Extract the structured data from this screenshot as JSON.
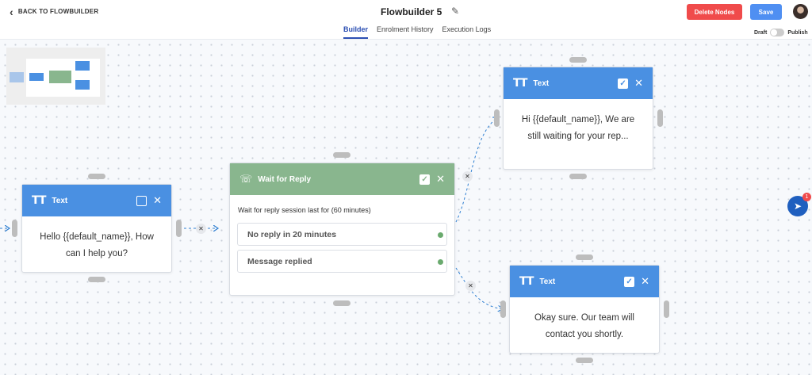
{
  "header": {
    "back_label": "BACK TO FLOWBUILDER",
    "title": "Flowbuilder 5",
    "tabs": [
      {
        "label": "Builder",
        "active": true
      },
      {
        "label": "Enrolment History",
        "active": false
      },
      {
        "label": "Execution Logs",
        "active": false
      }
    ],
    "delete_label": "Delete Nodes",
    "save_label": "Save",
    "draft_label": "Draft",
    "publish_label": "Publish"
  },
  "nodes": {
    "text1": {
      "title": "Text",
      "body": "Hello {{default_name}}, How can I help you?",
      "checked": false
    },
    "wait": {
      "title": "Wait for Reply",
      "description": "Wait for reply session last for (60 minutes)",
      "options": [
        "No reply in 20 minutes",
        "Message replied"
      ],
      "checked": true
    },
    "text2": {
      "title": "Text",
      "body": "Hi {{default_name}}, We are still waiting for your rep...",
      "checked": true
    },
    "text3": {
      "title": "Text",
      "body": "Okay sure. Our team will contact you shortly.",
      "checked": true
    }
  },
  "widget": {
    "badge_count": "1"
  },
  "colors": {
    "text_node_header": "#4a90e2",
    "wait_node_header": "#89b68e",
    "delete_button": "#f04b4b",
    "save_button": "#4f8ff2",
    "active_tab": "#2c4fb3",
    "edge": "#2f7fd1"
  },
  "icons": {
    "back": "chevron-left-icon",
    "edit": "pencil-icon",
    "text_node": "text-format-icon",
    "wait_node": "phone-wait-icon",
    "widget": "send-icon"
  }
}
